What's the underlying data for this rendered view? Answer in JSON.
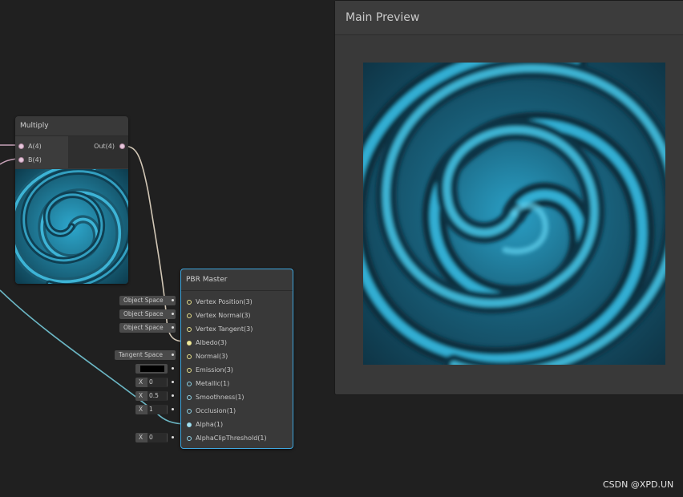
{
  "multiply_node": {
    "title": "Multiply",
    "input_a": "A(4)",
    "input_b": "B(4)",
    "output": "Out(4)"
  },
  "pbr_master": {
    "title": "PBR Master",
    "ports": [
      {
        "label": "Vertex Position(3)",
        "input": "Object Space"
      },
      {
        "label": "Vertex Normal(3)",
        "input": "Object Space"
      },
      {
        "label": "Vertex Tangent(3)",
        "input": "Object Space"
      },
      {
        "label": "Albedo(3)",
        "input": ""
      },
      {
        "label": "Normal(3)",
        "input": "Tangent Space"
      },
      {
        "label": "Emission(3)",
        "input": "black"
      },
      {
        "label": "Metallic(1)",
        "input": "X",
        "value": "0"
      },
      {
        "label": "Smoothness(1)",
        "input": "X",
        "value": "0.5"
      },
      {
        "label": "Occlusion(1)",
        "input": "X",
        "value": "1"
      },
      {
        "label": "Alpha(1)",
        "input": ""
      },
      {
        "label": "AlphaClipThreshold(1)",
        "input": "X",
        "value": "0"
      }
    ]
  },
  "main_preview": {
    "title": "Main Preview"
  },
  "watermark": "CSDN @XPD.UN",
  "colors": {
    "background": "#202020",
    "node": "#393939",
    "selected_border": "#3fa7df",
    "vector4_wire": "#c6a1b7",
    "vector3_wire": "#d9d28a",
    "vector1_wire": "#6bb6c4",
    "swirl_cyan": "#1fa6cf"
  }
}
